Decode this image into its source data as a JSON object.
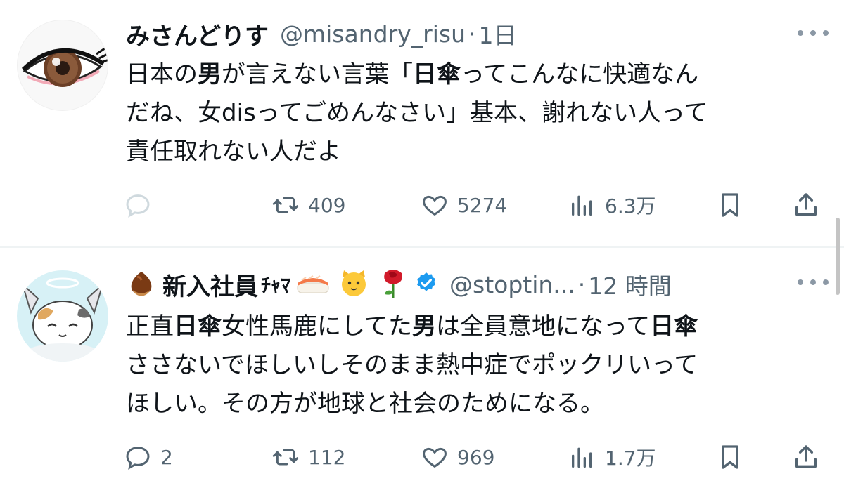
{
  "tweets": [
    {
      "display_name": "みさんどりす",
      "handle": "@misandry_risu",
      "separator": "·",
      "time": "1日",
      "body": {
        "line1_a": "日本の",
        "line1_bold1": "男",
        "line1_b": "が言えない言葉「",
        "line1_bold2": "日傘",
        "line1_c": "ってこんなに快適なん",
        "line2": "だね、女disってごめんなさい」基本、謝れない人って",
        "line3": "責任取れない人だよ"
      },
      "reply_count": "",
      "retweet_count": "409",
      "like_count": "5274",
      "view_count": "6.3万"
    },
    {
      "display_name": "新入社員",
      "display_name_suffix": "ﾁｬﾏ",
      "handle": "@stoptin...",
      "separator": "·",
      "time": "12 時間",
      "verified": true,
      "body": {
        "l1_a": "正直",
        "l1_bold1": "日傘",
        "l1_b": "女性馬鹿にしてた",
        "l1_bold2": "男",
        "l1_c": "は全員意地になって",
        "l1_bold3": "日傘",
        "line2": "ささないでほしいしそのまま熱中症でポックリいって",
        "line3": "ほしい。その方が地球と社会のためになる。"
      },
      "reply_count": "2",
      "retweet_count": "112",
      "like_count": "969",
      "view_count": "1.7万"
    }
  ],
  "colors": {
    "text": "#0f1419",
    "secondary": "#536471",
    "verified": "#1d9bf0",
    "divider": "#eff3f4"
  },
  "icons": [
    "reply-icon",
    "retweet-icon",
    "like-icon",
    "views-icon",
    "bookmark-icon",
    "share-icon",
    "more-icon",
    "verified-badge-icon"
  ]
}
